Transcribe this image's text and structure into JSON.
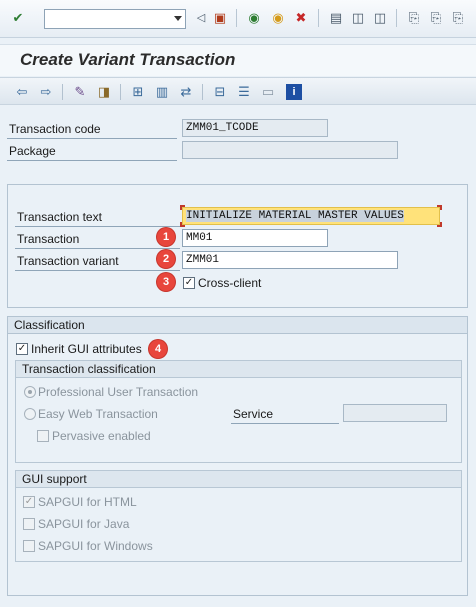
{
  "window": {
    "title": "Create Variant Transaction"
  },
  "command_field": {
    "value": ""
  },
  "icons": {
    "system_toolbar": [
      "enter-icon",
      "back-icon",
      "save-icon",
      "green-back-icon",
      "exit-icon",
      "cancel-icon",
      "print-icon",
      "find-icon",
      "find-next-icon",
      "first-page-icon",
      "prev-page-icon",
      "next-page-icon"
    ],
    "app_toolbar": [
      "back-arrow-icon",
      "forward-arrow-icon",
      "display-change-icon",
      "other-object-icon",
      "hierarchy-icon",
      "display-object-icon",
      "navigate-icon",
      "object-list-icon",
      "menu-icon",
      "window-icon",
      "info-icon"
    ]
  },
  "header_fields": {
    "transaction_code": {
      "label": "Transaction code",
      "value": "ZMM01_TCODE"
    },
    "package": {
      "label": "Package",
      "value": ""
    }
  },
  "main_fields": {
    "transaction_text": {
      "label": "Transaction text",
      "value": "INITIALIZE MATERIAL MASTER VALUES"
    },
    "transaction": {
      "label": "Transaction",
      "value": "MM01"
    },
    "transaction_variant": {
      "label": "Transaction variant",
      "value": "ZMM01"
    },
    "cross_client": {
      "label": "Cross-client",
      "checked": true
    }
  },
  "classification": {
    "title": "Classification",
    "inherit_gui": {
      "label": "Inherit GUI attributes",
      "checked": true
    },
    "transaction_classification": {
      "title": "Transaction classification",
      "professional": {
        "label": "Professional User Transaction",
        "selected": true
      },
      "easy_web": {
        "label": "Easy Web Transaction",
        "selected": false
      },
      "service": {
        "label": "Service",
        "value": ""
      },
      "pervasive": {
        "label": "Pervasive enabled",
        "checked": false
      }
    },
    "gui_support": {
      "title": "GUI support",
      "html": {
        "label": "SAPGUI for HTML",
        "checked": true
      },
      "java": {
        "label": "SAPGUI for Java",
        "checked": false
      },
      "windows": {
        "label": "SAPGUI for Windows",
        "checked": false
      }
    }
  },
  "callouts": {
    "one": "1",
    "two": "2",
    "three": "3",
    "four": "4"
  },
  "colors": {
    "callout": "#e8463c",
    "highlight": "#ffe27a",
    "background": "#eaf1f7"
  }
}
